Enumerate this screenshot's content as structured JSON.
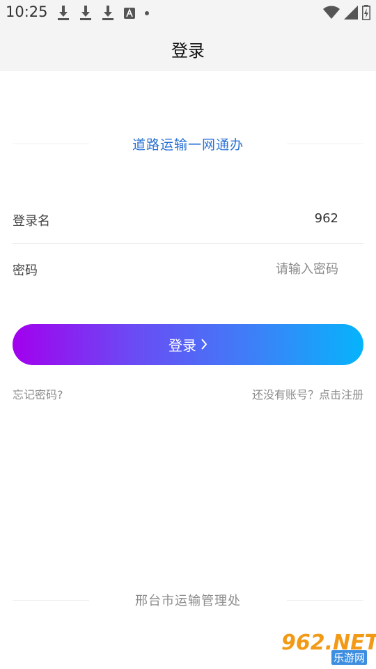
{
  "status_bar": {
    "time": "10:25",
    "left_icons": [
      "download-icon",
      "download-icon",
      "download-icon",
      "text-a-icon",
      "notification-dot"
    ],
    "right_icons": [
      "wifi-icon",
      "signal-icon",
      "battery-icon"
    ]
  },
  "header": {
    "title": "登录"
  },
  "brand": {
    "text": "道路运输一网通办",
    "color": "#2a72d4"
  },
  "form": {
    "username": {
      "label": "登录名",
      "value": "962"
    },
    "password": {
      "label": "密码",
      "placeholder": "请输入密码"
    },
    "submit_label": "登录",
    "submit_gradient": [
      "#a200ee",
      "#06b4fb"
    ]
  },
  "links": {
    "forgot": "忘记密码?",
    "register": "还没有账号？点击注册"
  },
  "footer": {
    "text": "邢台市运输管理处"
  },
  "watermark": {
    "main": "962.NET",
    "sub": "乐游网"
  }
}
